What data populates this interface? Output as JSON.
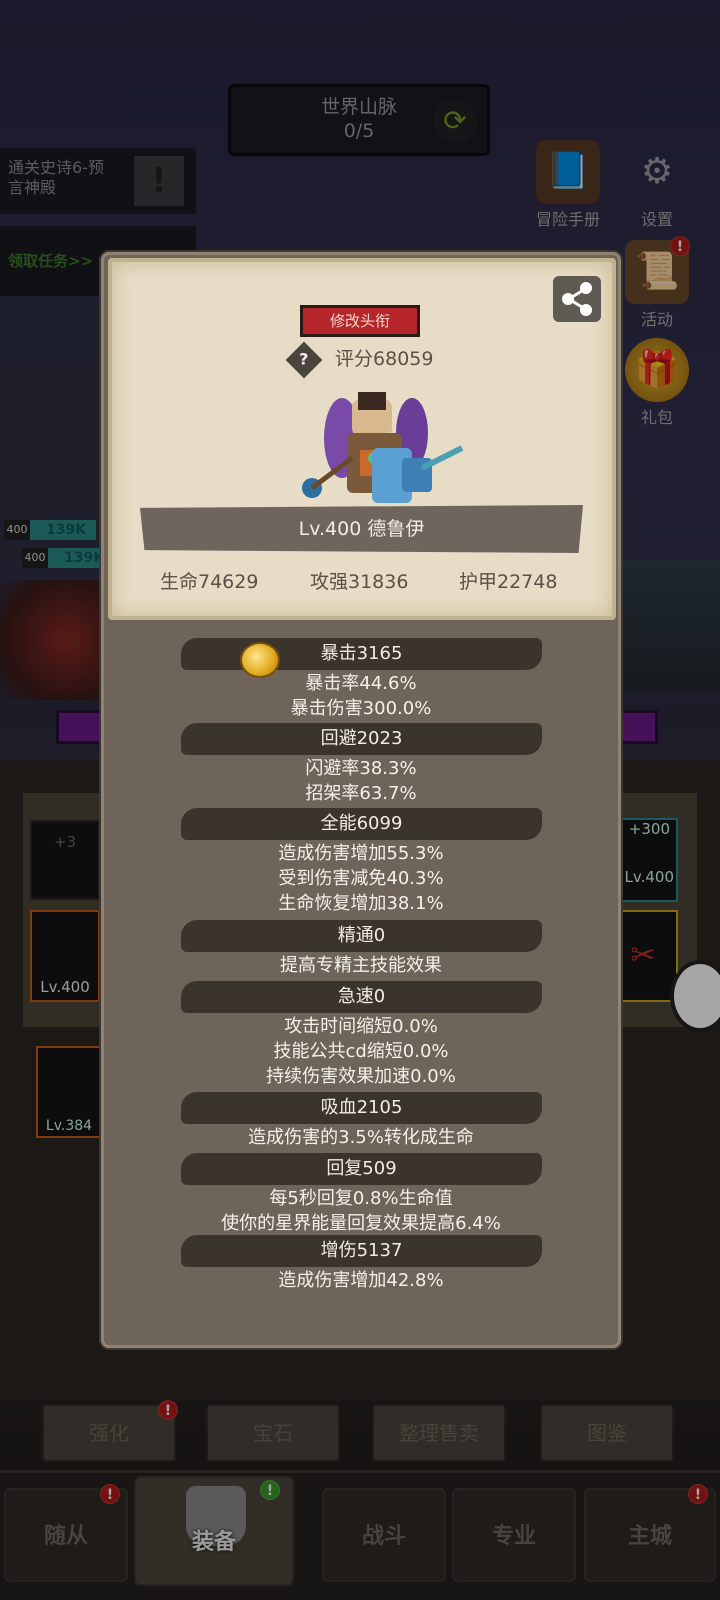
{
  "hud": {
    "zone": {
      "name": "世界山脉",
      "progress": "0/5"
    },
    "quests": [
      {
        "text": "通关史诗6-预\n言神殿"
      },
      {
        "text": "领取任务>>"
      }
    ],
    "side_buttons": [
      {
        "label": "冒险手册"
      },
      {
        "label": "设置"
      },
      {
        "label": "活动"
      },
      {
        "label": "礼包"
      }
    ],
    "bars": [
      {
        "level": "400",
        "value": "139K"
      },
      {
        "level": "400",
        "value": "139K"
      }
    ],
    "slots": [
      {
        "text": "+3"
      },
      {
        "text": "+300"
      },
      {
        "text": "Lv.400"
      },
      {
        "text": "Lv.400"
      },
      {
        "text": "Lv.384"
      }
    ],
    "bottom_buttons": [
      "强化",
      "宝石",
      "整理售卖",
      "图鉴"
    ],
    "nav": [
      "随从",
      "装备",
      "战斗",
      "专业",
      "主城"
    ],
    "badge_mark": "!"
  },
  "profile": {
    "title_button": "修改头衔",
    "help_mark": "?",
    "score": "评分68059",
    "name": "Lv.400 德鲁伊",
    "hp": "生命74629",
    "attack": "攻强31836",
    "armor": "护甲22748"
  },
  "stats": [
    {
      "title": "暴击3165",
      "lines": [
        "暴击率44.6%",
        "暴击伤害300.0%"
      ]
    },
    {
      "title": "回避2023",
      "lines": [
        "闪避率38.3%",
        "招架率63.7%"
      ]
    },
    {
      "title": "全能6099",
      "lines": [
        "造成伤害增加55.3%",
        "受到伤害减免40.3%",
        "生命恢复增加38.1%"
      ]
    },
    {
      "title": "精通0",
      "lines": [
        "提高专精主技能效果"
      ]
    },
    {
      "title": "急速0",
      "lines": [
        "攻击时间缩短0.0%",
        "技能公共cd缩短0.0%",
        "持续伤害效果加速0.0%"
      ]
    },
    {
      "title": "吸血2105",
      "lines": [
        "造成伤害的3.5%转化成生命"
      ]
    },
    {
      "title": "回复509",
      "lines": [
        "每5秒回复0.8%生命值",
        "使你的星界能量回复效果提高6.4%"
      ]
    },
    {
      "title": "增伤5137",
      "lines": [
        "造成伤害增加42.8%"
      ]
    }
  ]
}
